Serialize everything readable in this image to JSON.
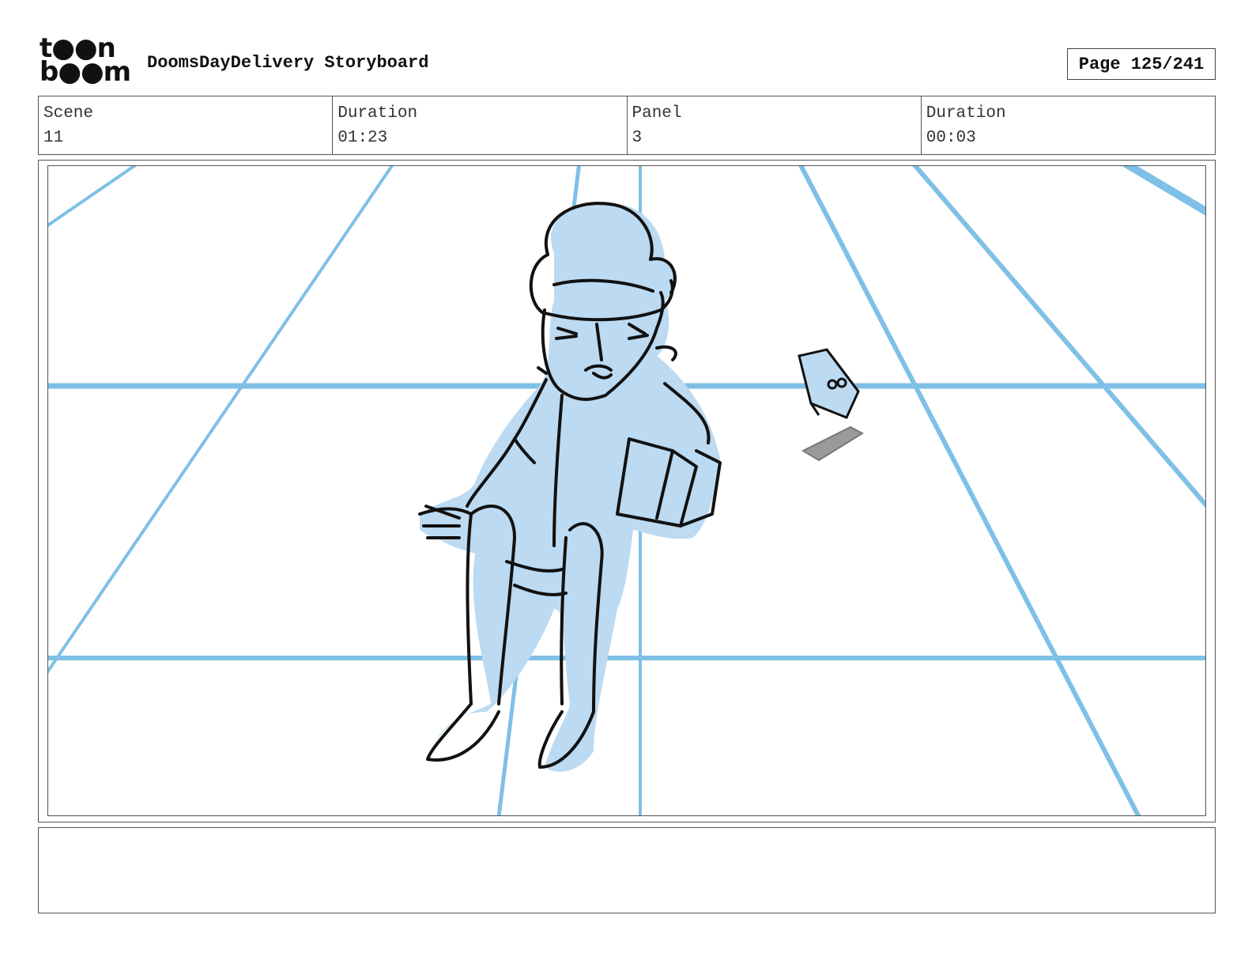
{
  "header": {
    "logo_line1": "t●●n",
    "logo_line2": "b●●m",
    "title": "DoomsDayDelivery Storyboard",
    "page": "Page 125/241"
  },
  "info": {
    "scene_label": "Scene",
    "scene_value": "11",
    "scene_duration_label": "Duration",
    "scene_duration_value": "01:23",
    "panel_label": "Panel",
    "panel_value": "3",
    "panel_duration_label": "Duration",
    "panel_duration_value": "00:03"
  },
  "notes": {
    "text": ""
  },
  "colors": {
    "guide_blue": "#7fc0e6",
    "fill_blue": "#bcdaf1",
    "ink": "#111111",
    "prop_gray": "#9a9a9a"
  }
}
